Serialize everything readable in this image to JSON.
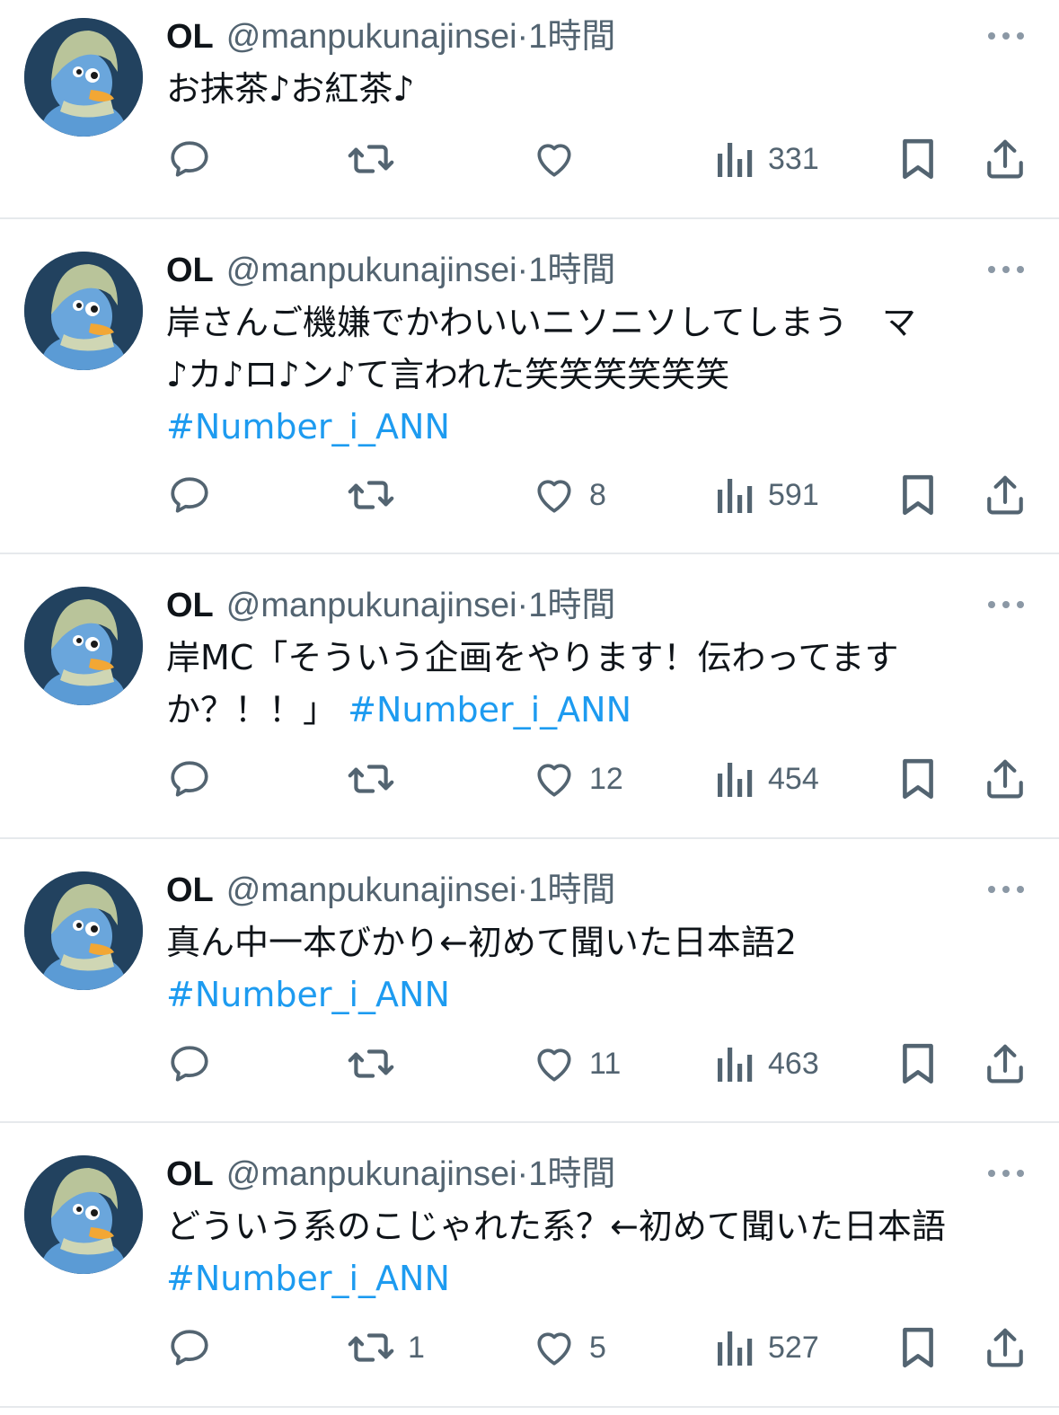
{
  "tweets": [
    {
      "name": "OL",
      "handle": "@manpukunajinsei",
      "sep": "·",
      "time": "1時間",
      "lines": [
        "お抹茶♪お紅茶♪"
      ],
      "hashtag_line": "",
      "hashtag_inline": "",
      "replies": "",
      "retweets": "",
      "likes": "",
      "views": "331"
    },
    {
      "name": "OL",
      "handle": "@manpukunajinsei",
      "sep": "·",
      "time": "1時間",
      "lines": [
        "岸さんご機嫌でかわいいニソニソしてしまう　マ",
        "♪カ♪ロ♪ン♪て言われた笑笑笑笑笑笑"
      ],
      "hashtag_line": "#Number_i_ANN",
      "hashtag_inline": "",
      "replies": "",
      "retweets": "",
      "likes": "8",
      "views": "591"
    },
    {
      "name": "OL",
      "handle": "@manpukunajinsei",
      "sep": "·",
      "time": "1時間",
      "lines": [
        "岸MC「そういう企画をやります！伝わってます",
        "か？！！」"
      ],
      "hashtag_line": "",
      "hashtag_inline": "#Number_i_ANN",
      "replies": "",
      "retweets": "",
      "likes": "12",
      "views": "454"
    },
    {
      "name": "OL",
      "handle": "@manpukunajinsei",
      "sep": "·",
      "time": "1時間",
      "lines": [
        "真ん中一本びかり←初めて聞いた日本語2"
      ],
      "hashtag_line": "#Number_i_ANN",
      "hashtag_inline": "",
      "replies": "",
      "retweets": "",
      "likes": "11",
      "views": "463"
    },
    {
      "name": "OL",
      "handle": "@manpukunajinsei",
      "sep": "·",
      "time": "1時間",
      "lines": [
        "どういう系のこじゃれた系？←初めて聞いた日本語"
      ],
      "hashtag_line": "#Number_i_ANN",
      "hashtag_inline": "",
      "replies": "",
      "retweets": "1",
      "likes": "5",
      "views": "527"
    }
  ],
  "icons": {
    "more": "more-dots-icon",
    "reply": "reply-icon",
    "retweet": "retweet-icon",
    "like": "heart-icon",
    "views": "views-chart-icon",
    "bookmark": "bookmark-icon",
    "share": "share-icon"
  },
  "colors": {
    "text": "#0f1419",
    "secondary": "#536471",
    "hashtag": "#1d9bf0",
    "divider": "#e6e9ec",
    "avatar_bg": "#22425f",
    "bird": "#5b9bd5",
    "scarf": "#b9c49a"
  }
}
